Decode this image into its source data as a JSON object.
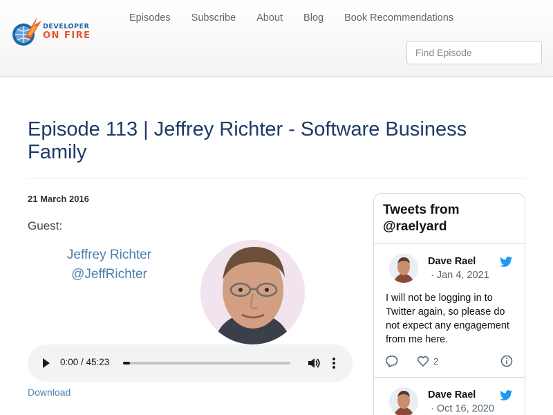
{
  "brand": {
    "line1": "DEVELOPER",
    "line2": "ON FIRE"
  },
  "nav": {
    "items": [
      "Episodes",
      "Subscribe",
      "About",
      "Blog",
      "Book Recommendations"
    ]
  },
  "search": {
    "placeholder": "Find Episode",
    "value": ""
  },
  "episode": {
    "title": "Episode 113 | Jeffrey Richter - Software Business Family",
    "date": "21 March 2016",
    "guest_label": "Guest:",
    "guest_name": "Jeffrey Richter",
    "guest_handle": "@JeffRichter"
  },
  "player": {
    "time": "0:00 / 45:23",
    "progress_fraction": 0.0
  },
  "download_label": "Download",
  "twitter": {
    "title": "Tweets from @raelyard",
    "tweets": [
      {
        "name": "Dave Rael",
        "date": "· Jan 4, 2021",
        "text": "I will not be logging in to Twitter again, so please do not expect any engagement from me here.",
        "likes": "2"
      },
      {
        "name": "Dave Rael",
        "date": "· Oct 16, 2020"
      }
    ]
  },
  "colors": {
    "title": "#1e3a66",
    "link": "#4a7fb0",
    "twitter_blue": "#1d9bf0",
    "brand_blue": "#1f67a3",
    "brand_orange": "#e8562a"
  }
}
